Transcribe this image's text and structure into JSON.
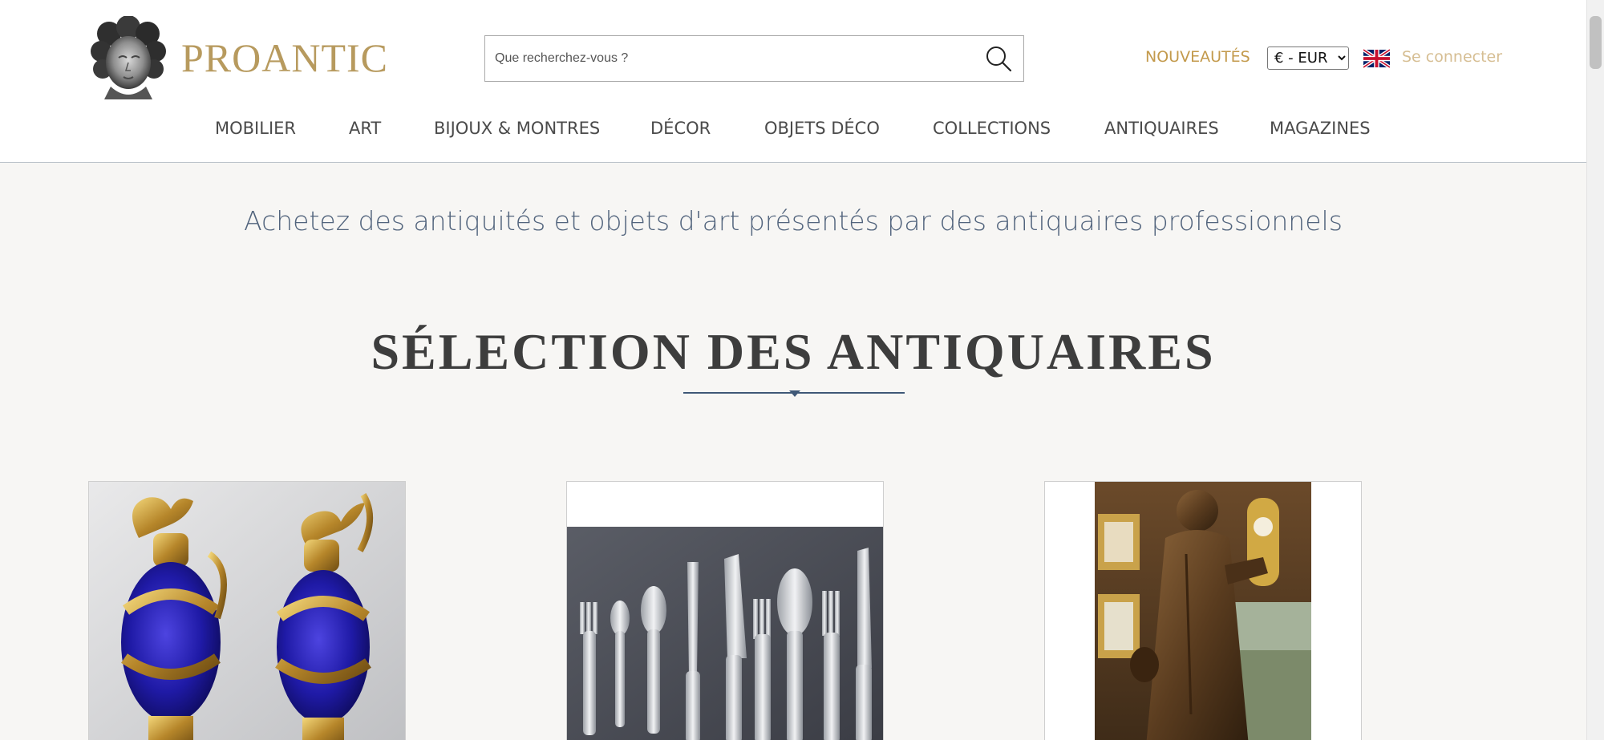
{
  "header": {
    "brand": "PROANTIC",
    "search": {
      "placeholder": "Que recherchez-vous ?",
      "value": ""
    },
    "nouveautes_label": "NOUVEAUTÉS",
    "currency": {
      "selected": "€ - EUR"
    },
    "language_flag": "uk-flag-icon",
    "login_label": "Se connecter"
  },
  "nav": {
    "items": [
      {
        "label": "MOBILIER"
      },
      {
        "label": "ART"
      },
      {
        "label": "BIJOUX & MONTRES"
      },
      {
        "label": "DÉCOR"
      },
      {
        "label": "OBJETS DÉCO"
      },
      {
        "label": "COLLECTIONS"
      },
      {
        "label": "ANTIQUAIRES"
      },
      {
        "label": "MAGAZINES"
      }
    ]
  },
  "main": {
    "tagline": "Achetez des antiquités et objets d'art présentés par des antiquaires professionnels",
    "section_title": "SÉLECTION DES ANTIQUAIRES",
    "products": [
      {
        "image": "cobalt-glass-ewers-pair"
      },
      {
        "image": "silver-cutlery-set"
      },
      {
        "image": "carved-wooden-saint-statue"
      }
    ]
  },
  "colors": {
    "brand_gold": "#b79a5e",
    "accent_gold": "#c39a4c",
    "login_gold": "#d6be93",
    "tagline_blue": "#52647d",
    "underline_blue": "#3f5877",
    "page_bg": "#f7f6f4"
  }
}
